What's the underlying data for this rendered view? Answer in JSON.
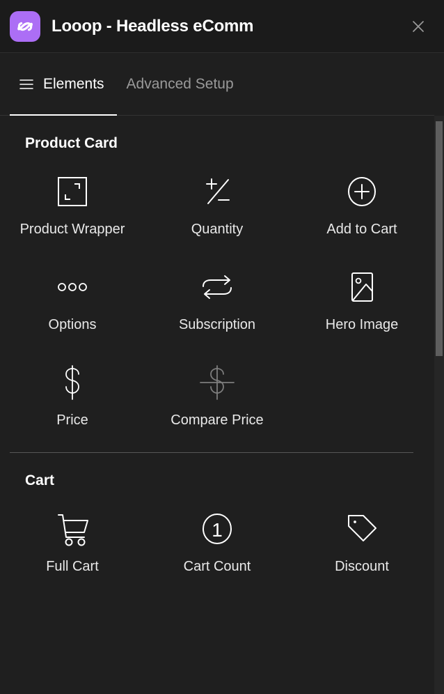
{
  "header": {
    "title": "Looop - Headless eComm",
    "logo_icon": "looop-logo-icon",
    "logo_color": "#ac6ef5",
    "close_icon": "close-icon"
  },
  "tabs": [
    {
      "label": "Elements",
      "icon": "hamburger-menu-icon",
      "active": true
    },
    {
      "label": "Advanced Setup",
      "icon": "",
      "active": false
    }
  ],
  "sections": [
    {
      "title": "Product Card",
      "items": [
        {
          "label": "Product Wrapper",
          "icon": "frame-corners-icon",
          "dim": false
        },
        {
          "label": "Quantity",
          "icon": "plus-minus-icon",
          "dim": false
        },
        {
          "label": "Add to Cart",
          "icon": "circle-plus-icon",
          "dim": false
        },
        {
          "label": "Options",
          "icon": "three-dots-icon",
          "dim": false
        },
        {
          "label": "Subscription",
          "icon": "repeat-loop-icon",
          "dim": false
        },
        {
          "label": "Hero Image",
          "icon": "image-icon",
          "dim": false
        },
        {
          "label": "Price",
          "icon": "dollar-sign-icon",
          "dim": false
        },
        {
          "label": "Compare Price",
          "icon": "dollar-sign-strikethrough-icon",
          "dim": true
        }
      ]
    },
    {
      "title": "Cart",
      "items": [
        {
          "label": "Full Cart",
          "icon": "shopping-cart-icon",
          "dim": false
        },
        {
          "label": "Cart Count",
          "icon": "circle-number-icon",
          "dim": false,
          "badge": "1"
        },
        {
          "label": "Discount",
          "icon": "tag-icon",
          "dim": false
        }
      ]
    }
  ],
  "colors": {
    "background": "#1f1f1f",
    "header_background": "#1b1b1b",
    "accent": "#ac6ef5",
    "text_primary": "#ffffff",
    "text_muted": "#9a9a9a",
    "divider": "#565656",
    "scrollbar_thumb": "#5e5e5e"
  }
}
